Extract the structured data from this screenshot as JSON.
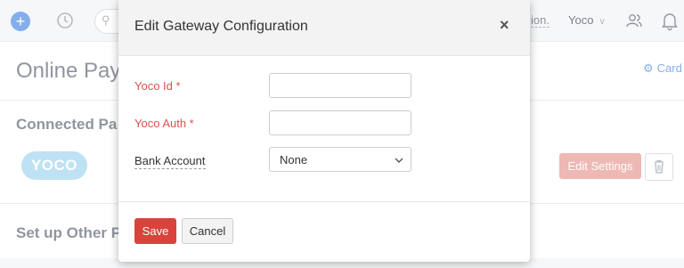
{
  "topbar": {
    "truncated_text": "ion.",
    "org_name": "Yoco"
  },
  "page": {
    "title": "Online Payr",
    "card_link": "Card",
    "connected_title": "Connected Pa",
    "gateway_logo_text": "YOCO",
    "edit_settings_label": "Edit Settings",
    "setup_other_title": "Set up Other P"
  },
  "modal": {
    "title": "Edit Gateway Configuration",
    "close_symbol": "×",
    "fields": [
      {
        "label": "Yoco Id *",
        "value": ""
      },
      {
        "label": "Yoco Auth *",
        "value": ""
      },
      {
        "label": "Bank Account",
        "value": "None"
      }
    ],
    "save_label": "Save",
    "cancel_label": "Cancel"
  },
  "colors": {
    "primary_red": "#d9433b",
    "faded_red": "#e9a19b",
    "link_blue": "#5b93e6",
    "yoco_blue": "#a8d8ef"
  }
}
